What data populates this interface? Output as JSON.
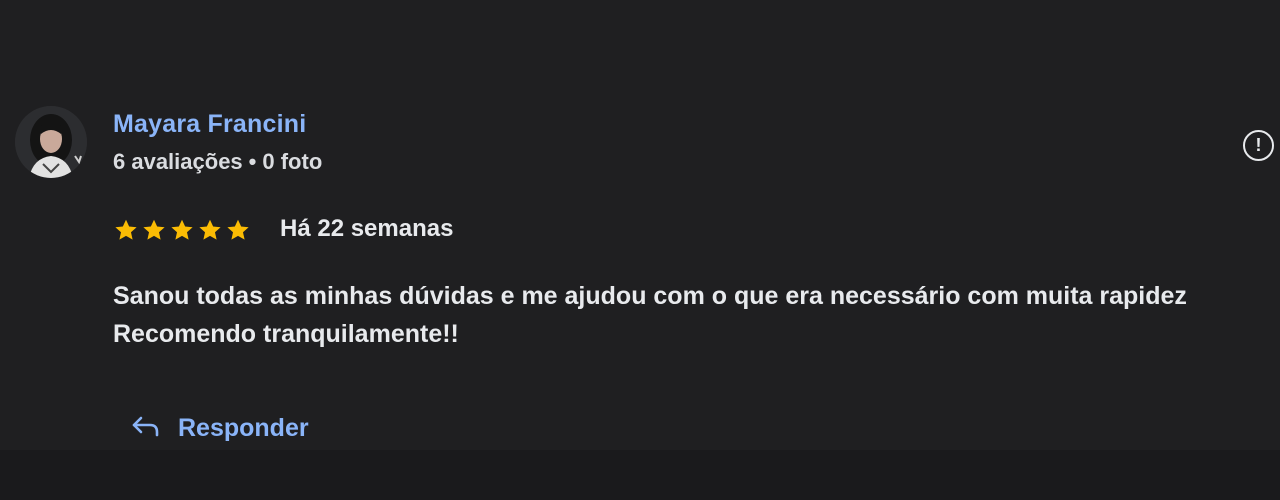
{
  "review": {
    "author": {
      "name": "Mayara Francini",
      "reviews_count": "6 avaliações",
      "separator": "•",
      "photos_count": "0 foto"
    },
    "rating": 5,
    "date": "Há 22 semanas",
    "text_lines": [
      "Sanou todas as minhas dúvidas e me ajudou com o que era necessário com muita rapidez",
      "Recomendo tranquilamente!!"
    ],
    "info_glyph": "!",
    "reply_label": "Responder"
  },
  "colors": {
    "background": "#1f1f21",
    "author_name": "#8ab4f8",
    "star": "#fbbc04",
    "reply": "#8ab4f8",
    "text": "#e8eaed"
  },
  "icons": {
    "info": "info-icon",
    "star": "star-icon",
    "reply": "reply-arrow-icon",
    "avatar": "avatar"
  }
}
